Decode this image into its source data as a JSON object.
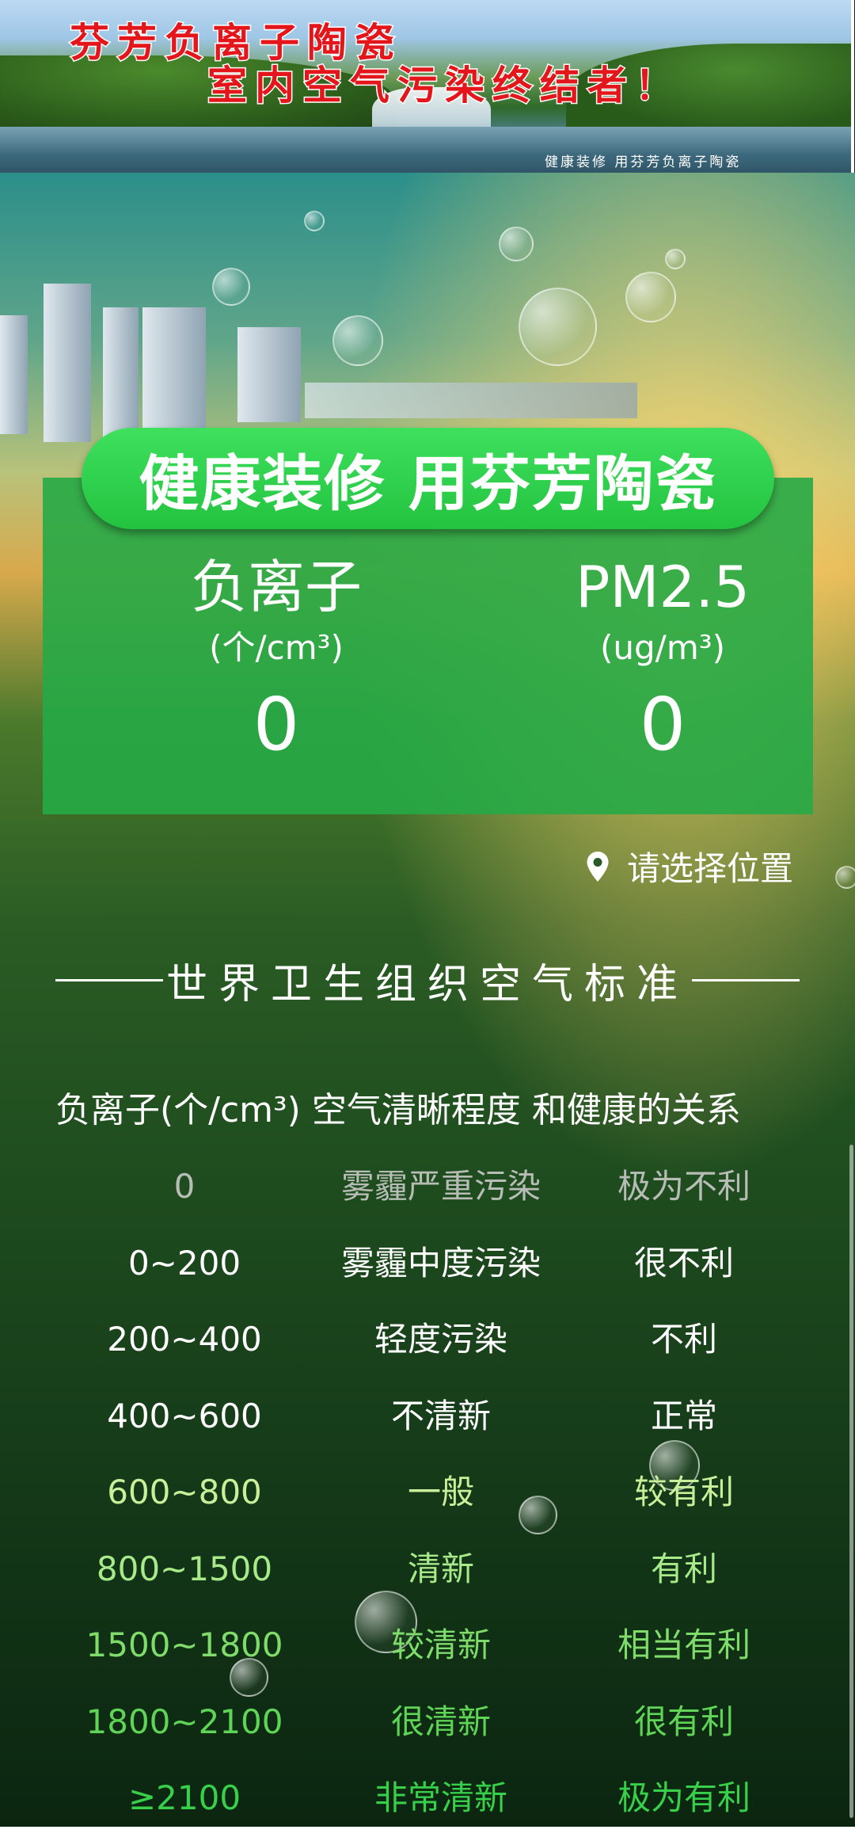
{
  "banner": {
    "line1": "芬芳负离子陶瓷",
    "line2": "室内空气污染终结者！",
    "caption": "健康装修  用芬芳负离子陶瓷"
  },
  "headline": "健康装修 用芬芳陶瓷",
  "metrics": {
    "ion": {
      "title": "负离子",
      "unit": "(个/cm³)",
      "value": "0"
    },
    "pm25": {
      "title": "PM2.5",
      "unit": "(ug/m³)",
      "value": "0"
    }
  },
  "location": {
    "label": "请选择位置",
    "icon": "location-pin-icon"
  },
  "who_standard": {
    "title": "世界卫生组织空气标准"
  },
  "table": {
    "header": "负离子(个/cm³) 空气清晰程度 和健康的关系",
    "rows": [
      {
        "range": "0",
        "clarity": "雾霾严重污染",
        "health": "极为不利",
        "color": "#b7bcb5"
      },
      {
        "range": "0~200",
        "clarity": "雾霾中度污染",
        "health": "很不利",
        "color": "#ffffff"
      },
      {
        "range": "200~400",
        "clarity": "轻度污染",
        "health": "不利",
        "color": "#ffffff"
      },
      {
        "range": "400~600",
        "clarity": "不清新",
        "health": "正常",
        "color": "#ffffff"
      },
      {
        "range": "600~800",
        "clarity": "一般",
        "health": "较有利",
        "color": "#c9ef9b"
      },
      {
        "range": "800~1500",
        "clarity": "清新",
        "health": "有利",
        "color": "#a8e98a"
      },
      {
        "range": "1500~1800",
        "clarity": "较清新",
        "health": "相当有利",
        "color": "#7fdc6a"
      },
      {
        "range": "1800~2100",
        "clarity": "很清新",
        "health": "很有利",
        "color": "#5fd456"
      },
      {
        "range": "≥2100",
        "clarity": "非常清新",
        "health": "极为有利",
        "color": "#38d04a"
      }
    ]
  }
}
